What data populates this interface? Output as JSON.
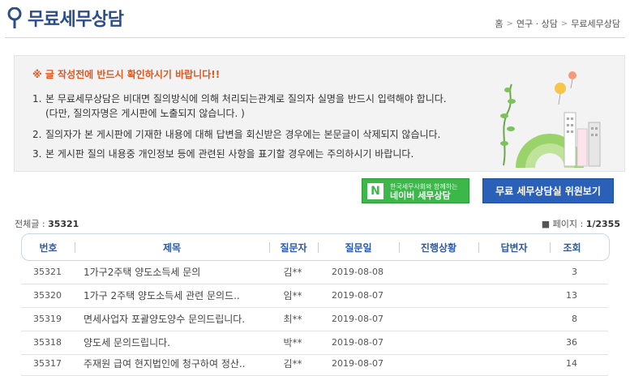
{
  "header": {
    "title": "무료세무상담",
    "breadcrumb": [
      "홈",
      "연구 · 상담",
      "무료세무상담"
    ]
  },
  "notice": {
    "warning": "※ 글 작성전에 반드시 확인하시기 바랍니다!!",
    "items": [
      {
        "num": "1.",
        "text": "본 무료세무상담은 비대면 질의방식에 의해 처리되는관계로 질의자 실명을 반드시 입력해야 합니다.",
        "sub": "(다만, 질의자명은 게시판에 노출되지 않습니다. )"
      },
      {
        "num": "2.",
        "text": "질의자가 본 게시판에 기재한 내용에 대해 답변을 회신받은 경우에는 본문글이 삭제되지 않습니다."
      },
      {
        "num": "3.",
        "text": "본 게시판 질의 내용중 개인정보 등에 관련된 사항을 표기할 경우에는 주의하시기 바랍니다."
      }
    ]
  },
  "buttons": {
    "naver_small": "한국세무사회와 함께하는",
    "naver_big": "네이버 세무상담",
    "naver_logo": "N",
    "committee": "무료 세무상담실 위원보기"
  },
  "stats": {
    "total_label": "전체글 :",
    "total_value": "35321",
    "page_label": "페이지 :",
    "page_value": "1/2355"
  },
  "table": {
    "headers": [
      "번호",
      "제목",
      "질문자",
      "질문일",
      "진행상황",
      "답변자",
      "조회"
    ],
    "rows": [
      {
        "num": "35321",
        "subject": "1가구2주택 양도소득세 문의",
        "asker": "김**",
        "date": "2019-08-08",
        "status": "",
        "answerer": "",
        "views": "3"
      },
      {
        "num": "35320",
        "subject": "1가구 2주택 양도소득세 관련 문의드..",
        "asker": "임**",
        "date": "2019-08-07",
        "status": "",
        "answerer": "",
        "views": "13"
      },
      {
        "num": "35319",
        "subject": "면세사업자 포괄양도양수 문의드립니다.",
        "asker": "최**",
        "date": "2019-08-07",
        "status": "",
        "answerer": "",
        "views": "8"
      },
      {
        "num": "35318",
        "subject": "양도세 문의드립니다.",
        "asker": "박**",
        "date": "2019-08-07",
        "status": "",
        "answerer": "",
        "views": "36"
      },
      {
        "num": "35317",
        "subject": "주재원 급여 현지법인에 청구하여 정산..",
        "asker": "김**",
        "date": "2019-08-07",
        "status": "",
        "answerer": "",
        "views": "14"
      }
    ]
  },
  "colors": {
    "title_blue": "#2a4d8c",
    "warning_orange": "#e2561d",
    "naver_green": "#3cb84b",
    "button_blue": "#2a60b7",
    "header_text_blue": "#2d5aa6"
  }
}
